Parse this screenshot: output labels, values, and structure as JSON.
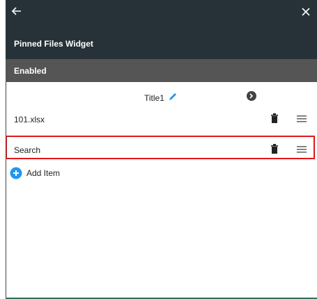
{
  "appbar": {
    "back_icon": "arrow-left-icon",
    "close_icon": "close-icon",
    "title": "Pinned Files Widget"
  },
  "status": {
    "label": "Enabled"
  },
  "header": {
    "title": "Title1",
    "edit_icon": "pencil-icon",
    "nav_icon": "chevron-right-circle-icon"
  },
  "items": [
    {
      "label": "101.xlsx"
    },
    {
      "label": "Search"
    }
  ],
  "add_item": {
    "label": "Add Item"
  },
  "colors": {
    "appbar": "#263238",
    "enabled": "#555555",
    "accent": "#2196f3",
    "highlight": "#e0161b"
  }
}
